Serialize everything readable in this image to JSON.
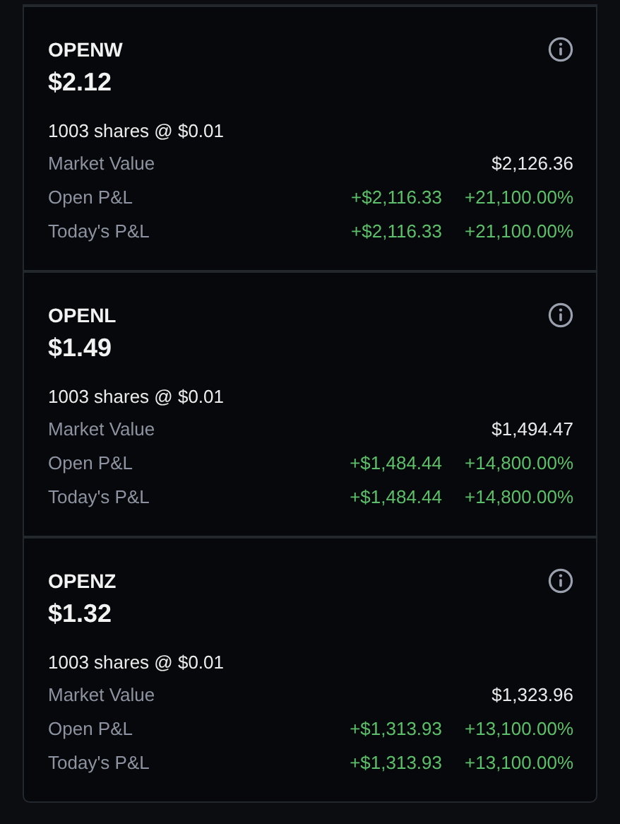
{
  "positions": [
    {
      "symbol": "OPENW",
      "price": "$2.12",
      "shares": "1003 shares @ $0.01",
      "rows": [
        {
          "label": "Market Value",
          "values": [
            {
              "text": "$2,126.36",
              "kind": "neutral"
            }
          ]
        },
        {
          "label": "Open P&L",
          "values": [
            {
              "text": "+$2,116.33",
              "kind": "gain"
            },
            {
              "text": "+21,100.00%",
              "kind": "gain"
            }
          ]
        },
        {
          "label": "Today's P&L",
          "values": [
            {
              "text": "+$2,116.33",
              "kind": "gain"
            },
            {
              "text": "+21,100.00%",
              "kind": "gain"
            }
          ]
        }
      ]
    },
    {
      "symbol": "OPENL",
      "price": "$1.49",
      "shares": "1003 shares @ $0.01",
      "rows": [
        {
          "label": "Market Value",
          "values": [
            {
              "text": "$1,494.47",
              "kind": "neutral"
            }
          ]
        },
        {
          "label": "Open P&L",
          "values": [
            {
              "text": "+$1,484.44",
              "kind": "gain"
            },
            {
              "text": "+14,800.00%",
              "kind": "gain"
            }
          ]
        },
        {
          "label": "Today's P&L",
          "values": [
            {
              "text": "+$1,484.44",
              "kind": "gain"
            },
            {
              "text": "+14,800.00%",
              "kind": "gain"
            }
          ]
        }
      ]
    },
    {
      "symbol": "OPENZ",
      "price": "$1.32",
      "shares": "1003 shares @ $0.01",
      "rows": [
        {
          "label": "Market Value",
          "values": [
            {
              "text": "$1,323.96",
              "kind": "neutral"
            }
          ]
        },
        {
          "label": "Open P&L",
          "values": [
            {
              "text": "+$1,313.93",
              "kind": "gain"
            },
            {
              "text": "+13,100.00%",
              "kind": "gain"
            }
          ]
        },
        {
          "label": "Today's P&L",
          "values": [
            {
              "text": "+$1,313.93",
              "kind": "gain"
            },
            {
              "text": "+13,100.00%",
              "kind": "gain"
            }
          ]
        }
      ]
    }
  ]
}
